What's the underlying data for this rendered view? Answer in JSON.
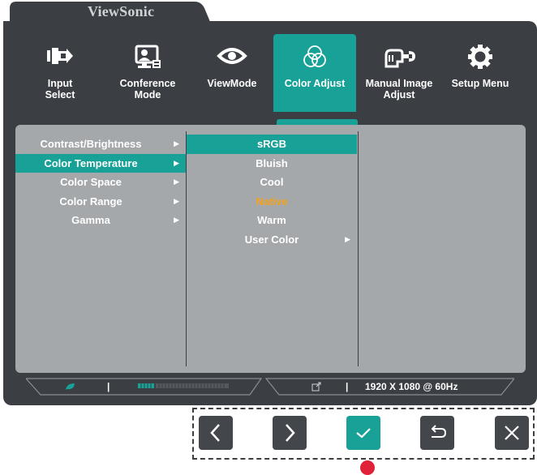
{
  "brand": {
    "name": "ViewSonic"
  },
  "colors": {
    "accent": "#17a197",
    "osd_bg": "#3b3f44",
    "panel_bg": "#a5a8ab",
    "highlight": "#f5a21b"
  },
  "menu": {
    "tabs": [
      {
        "label": "Input\nSelect",
        "icon": "input-select-icon"
      },
      {
        "label": "Conference\nMode",
        "icon": "conference-icon"
      },
      {
        "label": "ViewMode",
        "icon": "eye-icon"
      },
      {
        "label": "Color Adjust",
        "icon": "color-circles-icon",
        "active": true
      },
      {
        "label": "Manual Image\nAdjust",
        "icon": "hand-wrench-icon"
      },
      {
        "label": "Setup Menu",
        "icon": "gear-icon"
      }
    ]
  },
  "submenu": {
    "items": [
      {
        "label": "Contrast/Brightness"
      },
      {
        "label": "Color Temperature",
        "selected": true
      },
      {
        "label": "Color Space"
      },
      {
        "label": "Color Range"
      },
      {
        "label": "Gamma"
      }
    ]
  },
  "options": {
    "items": [
      {
        "label": "sRGB",
        "selected": true
      },
      {
        "label": "Bluish"
      },
      {
        "label": "Cool"
      },
      {
        "label": "Native",
        "current": true
      },
      {
        "label": "Warm"
      },
      {
        "label": "User Color",
        "has_submenu": true
      }
    ]
  },
  "status": {
    "resolution": "1920 X 1080 @ 60Hz",
    "separator": "|",
    "eco_icon": "eco-leaf-icon",
    "link_icon": "external-link-icon"
  },
  "controls": [
    {
      "icon": "chevron-left-icon"
    },
    {
      "icon": "chevron-right-icon"
    },
    {
      "icon": "checkmark-icon"
    },
    {
      "icon": "return-icon"
    },
    {
      "icon": "close-icon"
    }
  ]
}
